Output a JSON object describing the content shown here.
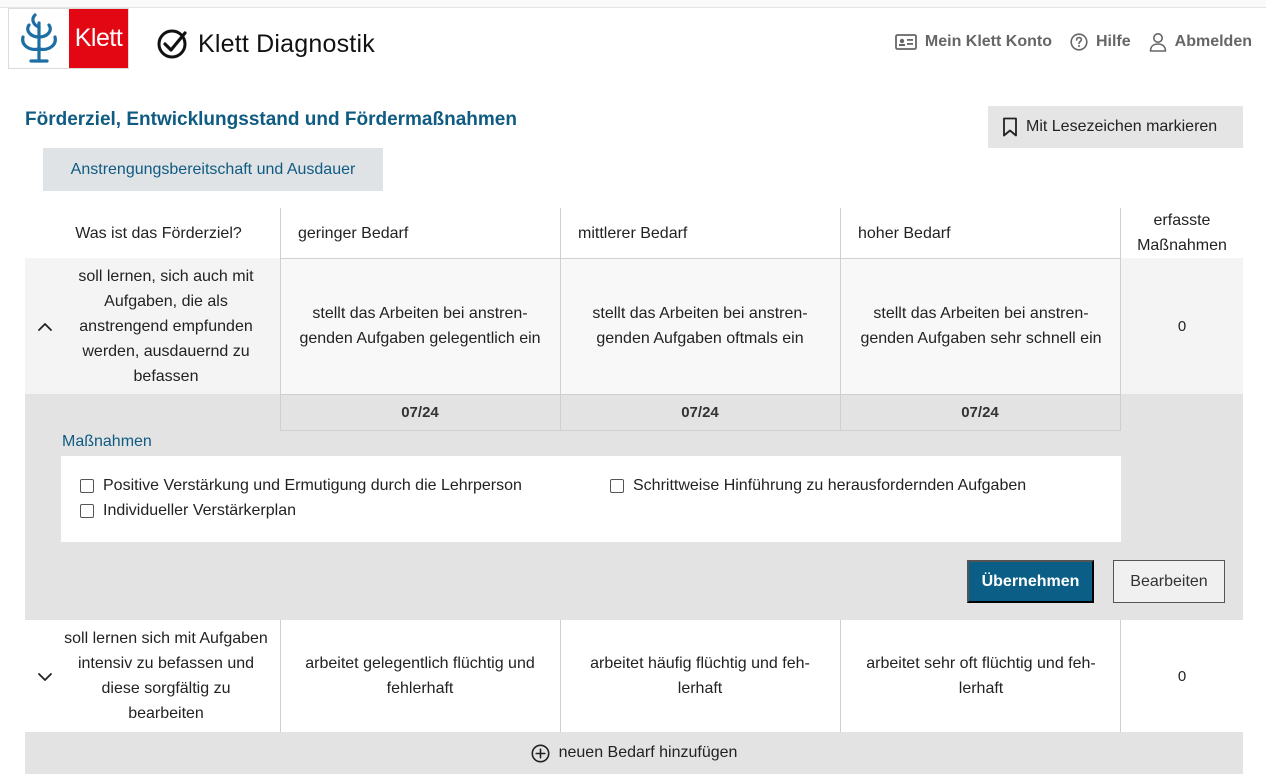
{
  "header": {
    "logo_text": "Klett",
    "app_name": "Klett Diagnostik",
    "nav": {
      "account": "Mein Klett Konto",
      "help": "Hilfe",
      "logout": "Abmelden"
    }
  },
  "section": {
    "title": "Förderziel, Entwicklungsstand und Fördermaßnahmen",
    "bookmark_label": "Mit Lesezeichen markieren",
    "subtab": "Anstrengungsbereitschaft und Ausdauer"
  },
  "table": {
    "headers": {
      "goal": "Was ist das Förderziel?",
      "low": "geringer Bedarf",
      "mid": "mittlerer Bedarf",
      "high": "hoher Bedarf",
      "count": "erfasste Maßnahmen"
    },
    "rows": [
      {
        "goal": "soll lernen, sich auch mit Aufgaben, die als anstrengend empfunden werden, ausdauernd zu befassen",
        "low": "stellt das Arbeiten bei anstren-genden Aufgaben gelegentlich ein",
        "mid": "stellt das Arbeiten bei anstren-genden Aufgaben oftmals ein",
        "high": "stellt das Arbeiten bei anstren-genden Aufgaben sehr schnell ein",
        "count": "0",
        "dates": [
          "07/24",
          "07/24",
          "07/24"
        ]
      },
      {
        "goal": "soll lernen sich mit Aufgaben intensiv zu befassen und diese sorgfältig zu bearbeiten",
        "low": "arbeitet gelegentlich flüchtig und fehlerhaft",
        "mid": "arbeitet häufig flüchtig und feh-lerhaft",
        "high": "arbeitet sehr oft flüchtig und feh-lerhaft",
        "count": "0"
      }
    ],
    "measures": {
      "label": "Maßnahmen",
      "items": [
        "Positive Verstärkung und Ermutigung durch die Lehrperson",
        "Individueller Verstärkerplan",
        "Schrittweise Hinführung zu herausfordernden Aufgaben"
      ],
      "apply_label": "Übernehmen",
      "edit_label": "Bearbeiten"
    },
    "add_label": "neuen Bedarf hinzufügen"
  },
  "colors": {
    "brand_red": "#e30613",
    "primary_blue": "#0b5f86",
    "title_blue": "#0f5b82"
  }
}
